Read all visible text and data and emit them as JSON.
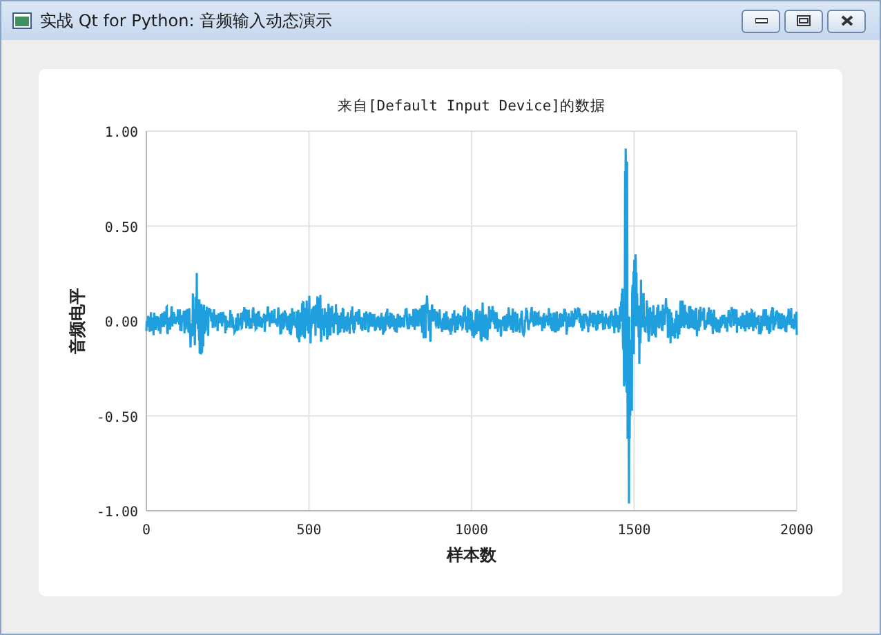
{
  "window": {
    "title": "实战 Qt for Python: 音频输入动态演示"
  },
  "chart": {
    "title": "来自[Default Input Device]的数据",
    "x_axis_label": "样本数",
    "y_axis_label": "音频电平",
    "x_tick_labels": [
      "0",
      "500",
      "1000",
      "1500",
      "2000"
    ],
    "y_tick_labels": [
      "1.00",
      "0.50",
      "0.00",
      "-0.50",
      "-1.00"
    ]
  }
}
